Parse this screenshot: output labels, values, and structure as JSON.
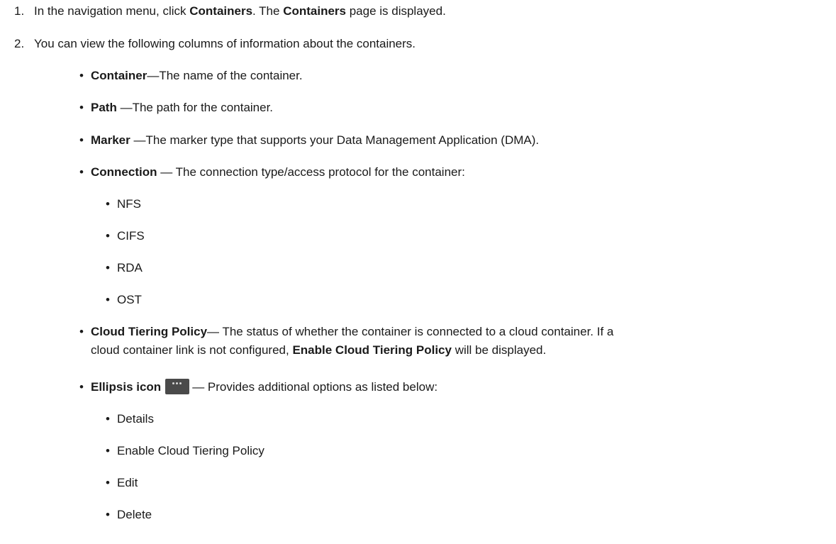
{
  "steps": [
    {
      "number": "1.",
      "text_before": "In the navigation menu, click ",
      "bold1": "Containers",
      "text_middle": ". The ",
      "bold2": "Containers",
      "text_after": " page is displayed."
    },
    {
      "number": "2.",
      "text": "You can view the following columns of information about the containers."
    }
  ],
  "columns": [
    {
      "term": "Container",
      "desc": "—The name of the container."
    },
    {
      "term": "Path",
      "desc": " —The path for the container."
    },
    {
      "term": "Marker",
      "desc": " —The marker type that supports your Data Management Application (DMA)."
    },
    {
      "term": "Connection",
      "desc": " — The connection type/access protocol for the container:"
    }
  ],
  "connection_types": [
    "NFS",
    "CIFS",
    "RDA",
    "OST"
  ],
  "cloud_tiering": {
    "term": "Cloud Tiering Policy",
    "desc_line1": "— The status of whether the container is connected to a cloud container. If a",
    "desc_line2_before": "cloud container link is not configured, ",
    "desc_line2_bold": "Enable Cloud Tiering Policy",
    "desc_line2_after": " will be displayed."
  },
  "ellipsis": {
    "term": "Ellipsis icon",
    "desc": "— Provides additional options as listed below:",
    "icon": "ellipsis-icon"
  },
  "ellipsis_options": [
    "Details",
    "Enable Cloud Tiering Policy",
    "Edit",
    "Delete"
  ],
  "bullet_char": "•"
}
